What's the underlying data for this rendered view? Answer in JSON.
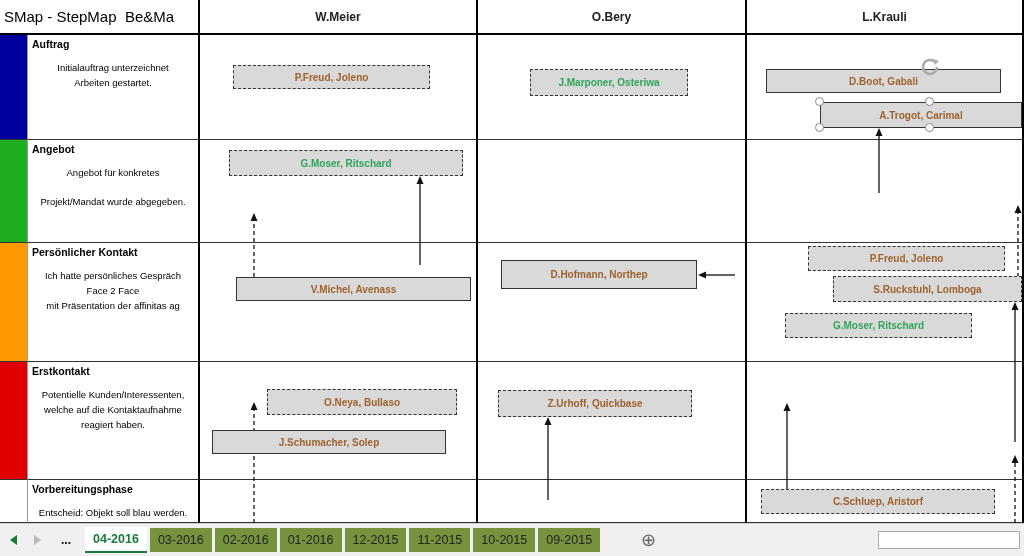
{
  "title": "SMap - StepMap  Be&Ma",
  "people": [
    "W.Meier",
    "O.Bery",
    "L.Krauli"
  ],
  "phases": [
    {
      "title": "Auftrag",
      "color": "#00009c",
      "lines": [
        "Initialauftrag unterzeichnet",
        "Arbeiten gestartet."
      ],
      "cells": [
        [
          {
            "label": "P.Freud, Joleno",
            "dashed": true,
            "color": "#a0622d",
            "selected": false
          }
        ],
        [
          {
            "label": "J.Marponer, Osteriwa",
            "dashed": true,
            "color": "#2ea55a",
            "selected": false
          }
        ],
        [
          {
            "label": "D.Boot, Gabali",
            "dashed": false,
            "color": "#a0622d",
            "selected": false
          },
          {
            "label": "A.Trogot, Carimal",
            "dashed": false,
            "color": "#a0622d",
            "selected": true
          }
        ]
      ]
    },
    {
      "title": "Angebot",
      "color": "#1fae1f",
      "lines": [
        "Angebot für konkretes",
        "Projekt/Mandat wurde abgegeben."
      ],
      "cells": [
        [
          {
            "label": "G.Moser, Ritschard",
            "dashed": true,
            "color": "#2ea55a",
            "selected": false
          }
        ],
        [],
        []
      ]
    },
    {
      "title": "Persönlicher Kontakt",
      "color": "#ff9900",
      "lines": [
        "Ich hatte persönliches Gespräch",
        "Face 2 Face",
        "mit Präsentation der affinitas ag"
      ],
      "cells": [
        [
          {
            "label": "V.Michel, Avenass",
            "dashed": false,
            "color": "#a0622d",
            "selected": false
          }
        ],
        [
          {
            "label": "D.Hofmann, Northep",
            "dashed": false,
            "color": "#a0622d",
            "selected": false
          }
        ],
        [
          {
            "label": "P.Freud, Joleno",
            "dashed": true,
            "color": "#a0622d",
            "selected": false
          },
          {
            "label": "S.Ruckstuhl, Lomboga",
            "dashed": true,
            "color": "#a0622d",
            "selected": false
          },
          {
            "label": "G.Moser, Ritschard",
            "dashed": true,
            "color": "#2ea55a",
            "selected": false
          }
        ]
      ]
    },
    {
      "title": "Erstkontakt",
      "color": "#e00000",
      "lines": [
        "Potentielle Kunden/Interessenten,",
        "welche auf die Kontaktaufnahme",
        "reagiert haben."
      ],
      "cells": [
        [
          {
            "label": "O.Neya, Bullaso",
            "dashed": true,
            "color": "#a0622d",
            "selected": false
          },
          {
            "label": "J.Schumacher, Solep",
            "dashed": false,
            "color": "#a0622d",
            "selected": false
          }
        ],
        [
          {
            "label": "Z.Urhoff, Quickbase",
            "dashed": true,
            "color": "#a0622d",
            "selected": false
          }
        ],
        []
      ]
    },
    {
      "title": "Vorbereitungsphase",
      "color": "#ffffff",
      "lines": [
        "Entscheid: Objekt soll blau werden."
      ],
      "cells": [
        [],
        [],
        [
          {
            "label": "C.Schluep, Aristorf",
            "dashed": true,
            "color": "#a0622d",
            "selected": false
          }
        ]
      ]
    }
  ],
  "sheet_tabs": {
    "more": "...",
    "add": "⊕",
    "tabs": [
      {
        "label": "04-2016",
        "selected": true
      },
      {
        "label": "03-2016",
        "selected": false
      },
      {
        "label": "02-2016",
        "selected": false
      },
      {
        "label": "01-2016",
        "selected": false
      },
      {
        "label": "12-2015",
        "selected": false
      },
      {
        "label": "11-2015",
        "selected": false
      },
      {
        "label": "10-2015",
        "selected": false
      },
      {
        "label": "09-2015",
        "selected": false
      }
    ]
  }
}
